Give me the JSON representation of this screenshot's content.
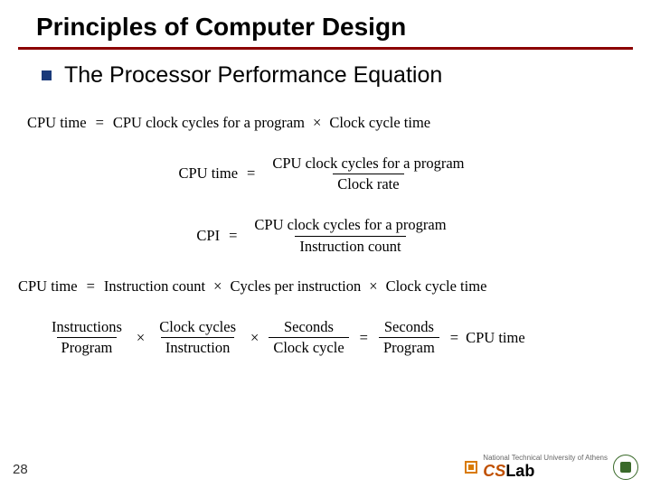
{
  "title": "Principles of Computer Design",
  "subtitle": "The Processor Performance Equation",
  "equations": {
    "eq1": {
      "lhs": "CPU time",
      "op": "=",
      "rhs1": "CPU clock cycles for a program",
      "mult": "×",
      "rhs2": "Clock cycle time"
    },
    "eq2": {
      "lhs": "CPU time",
      "op": "=",
      "num": "CPU clock cycles for a program",
      "den": "Clock rate"
    },
    "eq3": {
      "lhs": "CPI",
      "op": "=",
      "num": "CPU clock cycles for a program",
      "den": "Instruction count"
    },
    "eq4": {
      "lhs": "CPU time",
      "op": "=",
      "t1": "Instruction count",
      "m1": "×",
      "t2": "Cycles per instruction",
      "m2": "×",
      "t3": "Clock cycle time"
    },
    "eq5": {
      "f1n": "Instructions",
      "f1d": "Program",
      "m1": "×",
      "f2n": "Clock cycles",
      "f2d": "Instruction",
      "m2": "×",
      "f3n": "Seconds",
      "f3d": "Clock cycle",
      "op1": "=",
      "f4n": "Seconds",
      "f4d": "Program",
      "op2": "=",
      "rhs": "CPU time"
    }
  },
  "pagenum": "28",
  "logo": {
    "top": "National Technical University of Athens",
    "main_c": "CS",
    "main_rest": "Lab"
  }
}
